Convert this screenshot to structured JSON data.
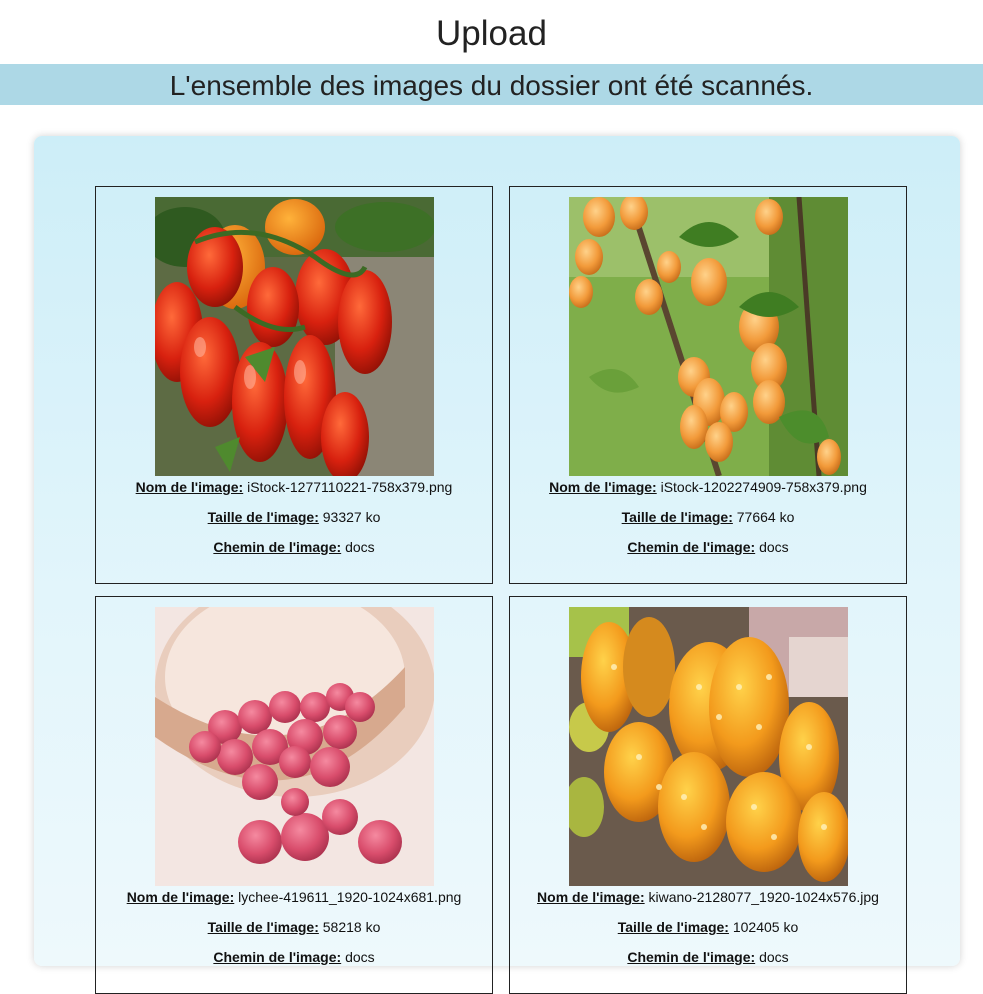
{
  "page": {
    "title": "Upload",
    "banner": "L'ensemble des images du dossier ont été scannés."
  },
  "labels": {
    "name": "Nom de l'image:",
    "size": "Taille de l'image:",
    "path": "Chemin de l'image:"
  },
  "images": [
    {
      "name": "iStock-1277110221-758x379.png",
      "size": "93327 ko",
      "path": "docs",
      "subject": "tomatoes"
    },
    {
      "name": "iStock-1202274909-758x379.png",
      "size": "77664 ko",
      "path": "docs",
      "subject": "apricots"
    },
    {
      "name": "lychee-419611_1920-1024x681.png",
      "size": "58218 ko",
      "path": "docs",
      "subject": "lychees"
    },
    {
      "name": "kiwano-2128077_1920-1024x576.jpg",
      "size": "102405 ko",
      "path": "docs",
      "subject": "kiwano"
    }
  ]
}
